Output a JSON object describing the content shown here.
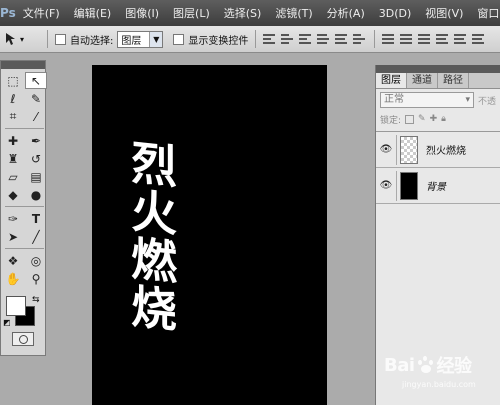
{
  "app": {
    "logo": "Ps"
  },
  "menu": [
    "文件(F)",
    "编辑(E)",
    "图像(I)",
    "图层(L)",
    "选择(S)",
    "滤镜(T)",
    "分析(A)",
    "3D(D)",
    "视图(V)",
    "窗口(W)"
  ],
  "options": {
    "auto_select_label": "自动选择:",
    "auto_select_value": "图层",
    "show_transform_label": "显示变换控件"
  },
  "canvas": {
    "text": "烈火燃烧"
  },
  "layers_panel": {
    "tabs": [
      "图层",
      "通道",
      "路径"
    ],
    "blend_mode": "正常",
    "opacity_label": "不透",
    "lock_label": "锁定:",
    "layers": [
      {
        "name": "烈火燃烧",
        "visible": true,
        "thumb": "transparent"
      },
      {
        "name": "背景",
        "visible": true,
        "thumb": "black"
      }
    ]
  },
  "watermark": {
    "brand": "Bai",
    "brand_suffix": "经验",
    "url": "jingyan.baidu.com"
  }
}
